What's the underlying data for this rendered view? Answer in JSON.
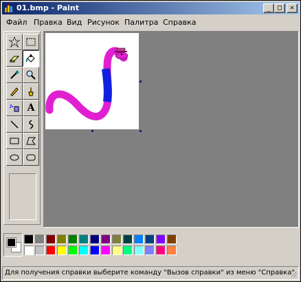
{
  "window": {
    "title": "01.bmp - Paint",
    "controls": {
      "minimize": "_",
      "maximize": "□",
      "close": "✕"
    }
  },
  "menu": {
    "items": [
      "Файл",
      "Правка",
      "Вид",
      "Рисунок",
      "Палитра",
      "Справка"
    ]
  },
  "tools": [
    {
      "name": "free-form-select-tool",
      "icon": "star-select-icon"
    },
    {
      "name": "select-tool",
      "icon": "rect-select-icon"
    },
    {
      "name": "eraser-tool",
      "icon": "eraser-icon"
    },
    {
      "name": "fill-tool",
      "icon": "paint-bucket-icon",
      "selected": true
    },
    {
      "name": "pick-color-tool",
      "icon": "eyedropper-icon"
    },
    {
      "name": "magnifier-tool",
      "icon": "magnifier-icon"
    },
    {
      "name": "pencil-tool",
      "icon": "pencil-icon"
    },
    {
      "name": "brush-tool",
      "icon": "brush-icon"
    },
    {
      "name": "airbrush-tool",
      "icon": "airbrush-icon"
    },
    {
      "name": "text-tool",
      "icon": "text-icon",
      "glyph": "A"
    },
    {
      "name": "line-tool",
      "icon": "line-icon"
    },
    {
      "name": "curve-tool",
      "icon": "curve-icon"
    },
    {
      "name": "rectangle-tool",
      "icon": "rectangle-icon"
    },
    {
      "name": "polygon-tool",
      "icon": "polygon-icon"
    },
    {
      "name": "ellipse-tool",
      "icon": "ellipse-icon"
    },
    {
      "name": "rounded-rectangle-tool",
      "icon": "rounded-rect-icon"
    }
  ],
  "palette": {
    "foreground": "#000000",
    "background": "#ffffff",
    "row1": [
      "#000000",
      "#808080",
      "#800000",
      "#808000",
      "#008000",
      "#008080",
      "#000080",
      "#800080",
      "#808040",
      "#004040",
      "#0080ff",
      "#004080",
      "#8000ff",
      "#804000"
    ],
    "row2": [
      "#ffffff",
      "#c0c0c0",
      "#ff0000",
      "#ffff00",
      "#00ff00",
      "#00ffff",
      "#0000ff",
      "#ff00ff",
      "#ffff80",
      "#00ff80",
      "#80ffff",
      "#8080ff",
      "#ff0080",
      "#ff8040"
    ]
  },
  "drawing": {
    "worm_body_color": "#e020d0",
    "worm_stripe_color": "#1020e0",
    "hat_color": "#c0408c"
  },
  "status": {
    "text": "Для получения справки выберите команду \"Вызов справки\" из меню \"Справка\"."
  }
}
